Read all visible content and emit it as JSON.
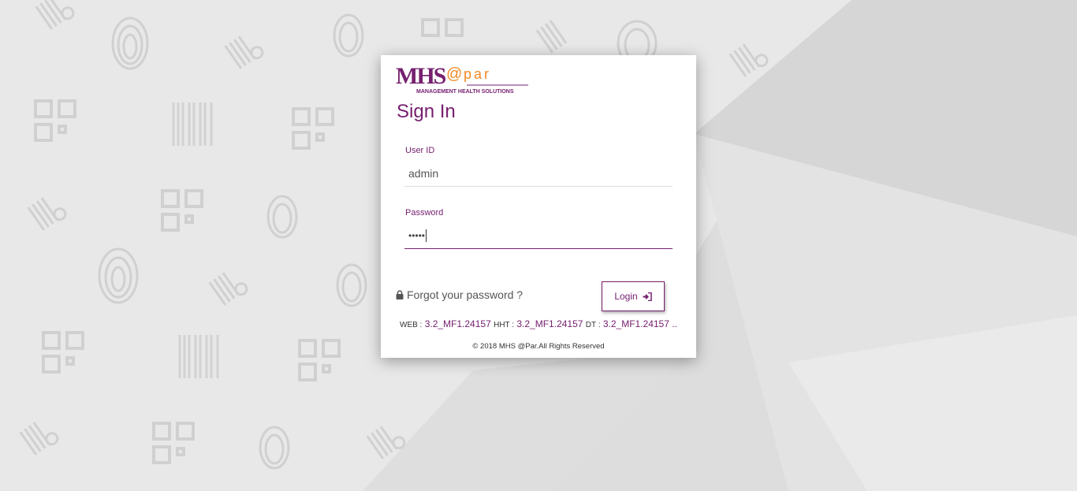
{
  "logo": {
    "brand_mark": "MHS",
    "brand_at": "@",
    "brand_par": "par",
    "brand_tagline": "MANAGEMENT HEALTH SOLUTIONS"
  },
  "form": {
    "title": "Sign In",
    "user_id_label": "User ID",
    "user_id_value": "admin",
    "password_label": "Password",
    "password_value": "•••••",
    "forgot_label": "Forgot your password ?",
    "login_label": "Login"
  },
  "versions": {
    "web_key": "WEB :",
    "web_value": "3.2_MF1.24157",
    "hht_key": "HHT :",
    "hht_value": "3.2_MF1.24157",
    "dt_key": "DT :",
    "dt_value": "3.2_MF1.24157 .."
  },
  "footer": {
    "copyright": "© 2018 MHS @Par.All Rights Reserved"
  },
  "background": {
    "pattern_icons": [
      "barcode-search-icon",
      "fingerprint-icon",
      "qr-code-icon",
      "barcode-icon"
    ]
  },
  "colors": {
    "brand_purple": "#76206f",
    "brand_orange": "#f08a24"
  }
}
